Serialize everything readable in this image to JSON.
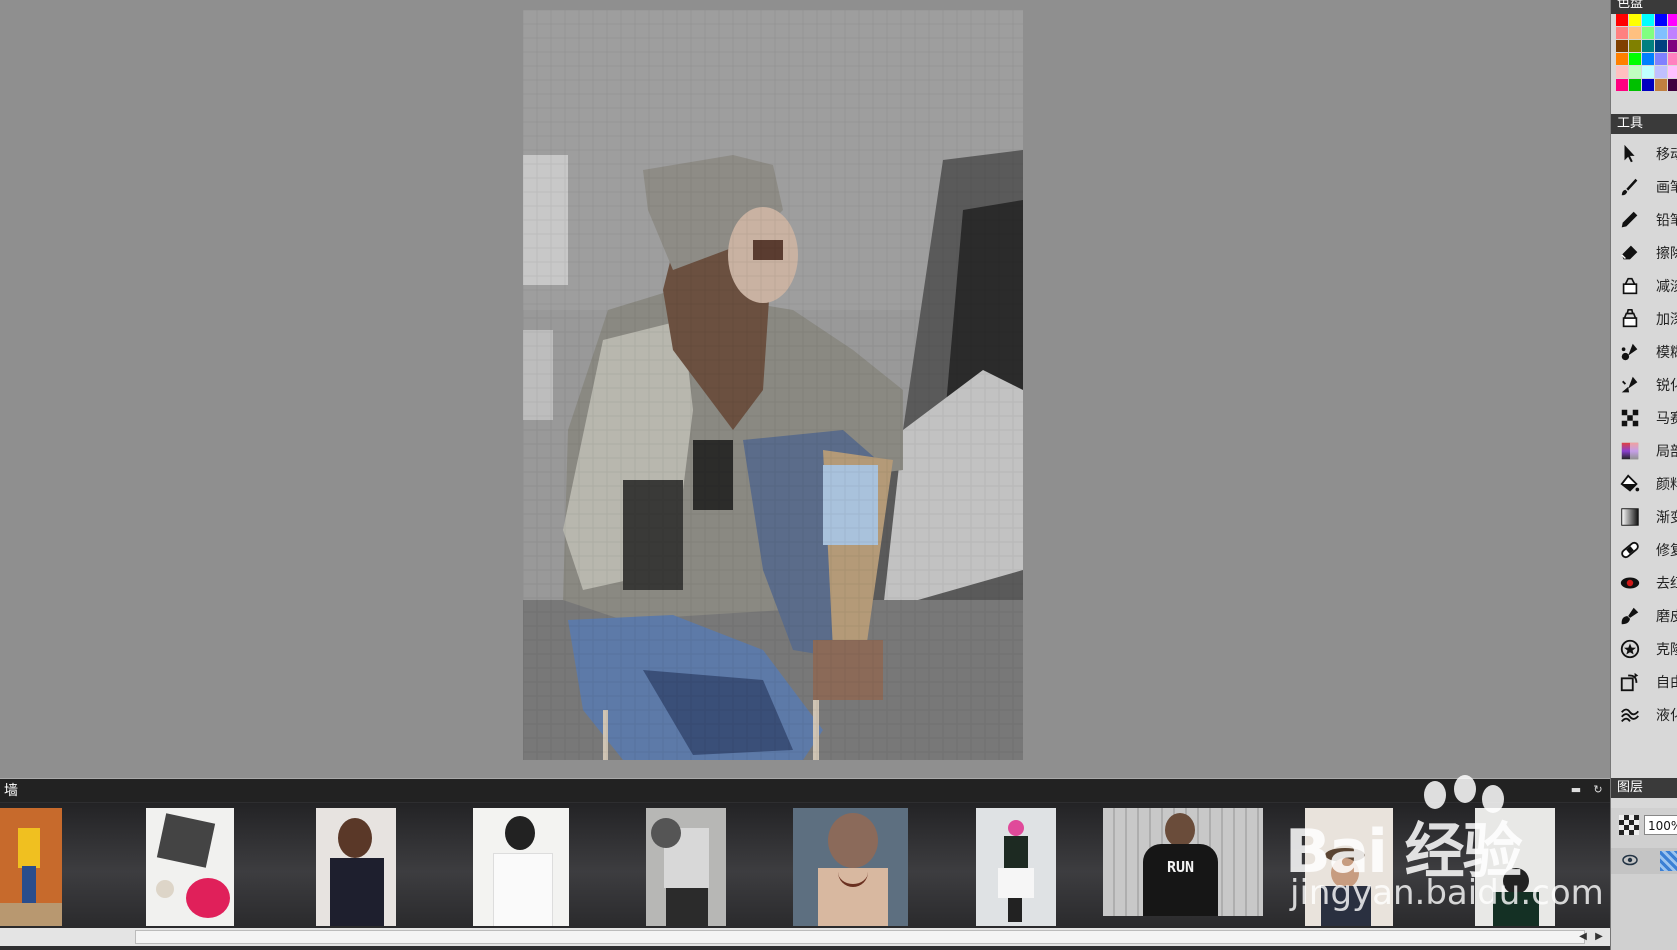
{
  "palette": {
    "title": "色盘",
    "colors": [
      "#ff0000",
      "#ffff00",
      "#00ffff",
      "#0000ff",
      "#ff00ff",
      "#ffffff",
      "#ff8080",
      "#ffc080",
      "#80ff80",
      "#80c0ff",
      "#c080ff",
      "#c0c0c0",
      "#804000",
      "#808000",
      "#008080",
      "#004080",
      "#800080",
      "#404040",
      "#ff8000",
      "#00ff00",
      "#0080ff",
      "#8080ff",
      "#ff80c0",
      "#000000",
      "#ffc0c0",
      "#c0ffc0",
      "#c0ffff",
      "#c0c0ff",
      "#ffc0ff",
      "#808080",
      "#ff0080",
      "#00c000",
      "#0000c0",
      "#c08040",
      "#400040",
      "#202020"
    ]
  },
  "tools": {
    "title": "工具",
    "items": [
      {
        "icon": "move-arrow-icon",
        "label": "移动"
      },
      {
        "icon": "brush-icon",
        "label": "画笔"
      },
      {
        "icon": "pencil-icon",
        "label": "铅笔"
      },
      {
        "icon": "eraser-icon",
        "label": "擦除"
      },
      {
        "icon": "dodge-bucket-icon",
        "label": "减淡"
      },
      {
        "icon": "burn-bucket-icon",
        "label": "加深"
      },
      {
        "icon": "blur-drops-icon",
        "label": "模糊"
      },
      {
        "icon": "sharpen-drops-icon",
        "label": "锐化"
      },
      {
        "icon": "mosaic-icon",
        "label": "马赛克"
      },
      {
        "icon": "local-color-icon",
        "label": "局部"
      },
      {
        "icon": "paint-bucket-icon",
        "label": "颜料"
      },
      {
        "icon": "gradient-icon",
        "label": "渐变"
      },
      {
        "icon": "bandage-icon",
        "label": "修复"
      },
      {
        "icon": "red-eye-icon",
        "label": "去红眼"
      },
      {
        "icon": "smooth-skin-icon",
        "label": "磨皮"
      },
      {
        "icon": "clone-stamp-icon",
        "label": "克隆"
      },
      {
        "icon": "free-transform-icon",
        "label": "自由变换"
      },
      {
        "icon": "liquify-icon",
        "label": "液化"
      }
    ]
  },
  "layers": {
    "title": "图层",
    "opacity": "100%"
  },
  "wall": {
    "title": "墙",
    "thumbnails": [
      {
        "name": "man-yellow-shirt"
      },
      {
        "name": "flowers-magazine"
      },
      {
        "name": "woman-dotted-dress"
      },
      {
        "name": "woman-white-shirt"
      },
      {
        "name": "woman-grey-hair-flowers"
      },
      {
        "name": "woman-necklace-back"
      },
      {
        "name": "woman-pink-hair-skirt"
      },
      {
        "name": "woman-run-hoodie"
      },
      {
        "name": "woman-hat"
      },
      {
        "name": "woman-black-top"
      }
    ],
    "hoodie_text": "RUN"
  },
  "watermark": {
    "logo": "Bai 经验",
    "url": "jingyan.baidu.com"
  }
}
